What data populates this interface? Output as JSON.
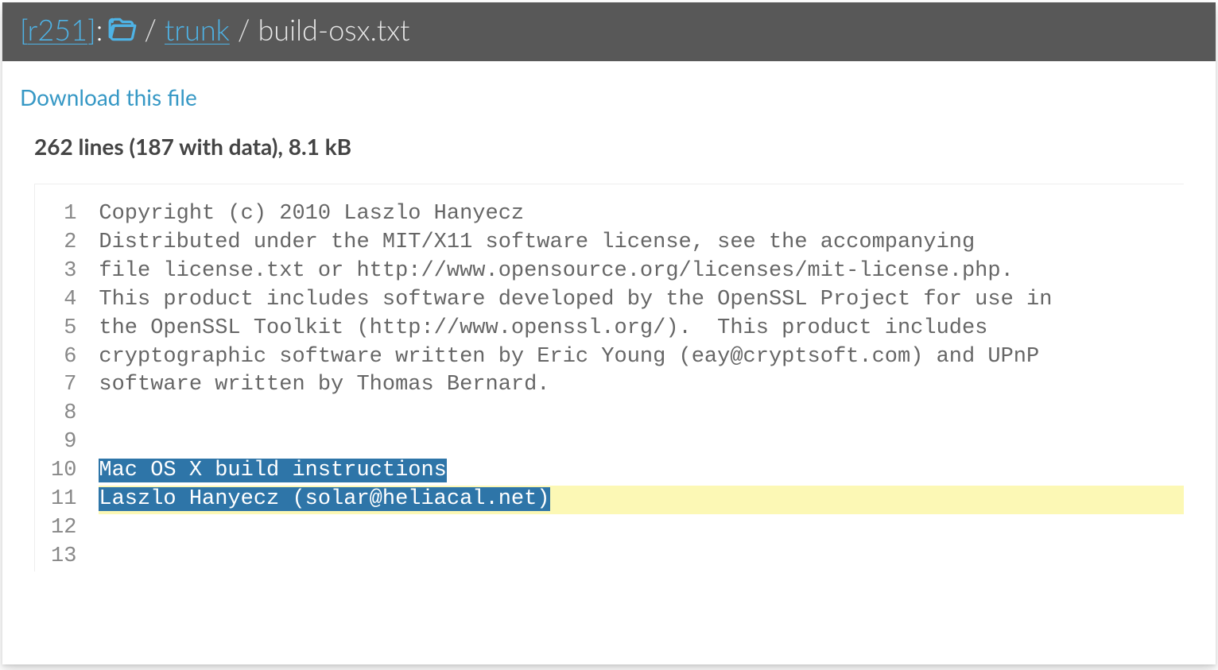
{
  "breadcrumb": {
    "revision_label": "r251",
    "trunk_label": "trunk",
    "filename": "build-osx.txt"
  },
  "download": {
    "label": "Download this file"
  },
  "stats": {
    "text": "262 lines (187 with data), 8.1 kB"
  },
  "code": {
    "lines": [
      {
        "n": 1,
        "text": "Copyright (c) 2010 Laszlo Hanyecz",
        "highlighted": false,
        "selected": false
      },
      {
        "n": 2,
        "text": "Distributed under the MIT/X11 software license, see the accompanying",
        "highlighted": false,
        "selected": false
      },
      {
        "n": 3,
        "text": "file license.txt or http://www.opensource.org/licenses/mit-license.php.",
        "highlighted": false,
        "selected": false
      },
      {
        "n": 4,
        "text": "This product includes software developed by the OpenSSL Project for use in",
        "highlighted": false,
        "selected": false
      },
      {
        "n": 5,
        "text": "the OpenSSL Toolkit (http://www.openssl.org/).  This product includes",
        "highlighted": false,
        "selected": false
      },
      {
        "n": 6,
        "text": "cryptographic software written by Eric Young (eay@cryptsoft.com) and UPnP ",
        "highlighted": false,
        "selected": false
      },
      {
        "n": 7,
        "text": "software written by Thomas Bernard.",
        "highlighted": false,
        "selected": false
      },
      {
        "n": 8,
        "text": "",
        "highlighted": false,
        "selected": false
      },
      {
        "n": 9,
        "text": "",
        "highlighted": false,
        "selected": false
      },
      {
        "n": 10,
        "text": "Mac OS X build instructions",
        "highlighted": false,
        "selected": true
      },
      {
        "n": 11,
        "text": "Laszlo Hanyecz (solar@heliacal.net)",
        "highlighted": true,
        "selected": true
      },
      {
        "n": 12,
        "text": "",
        "highlighted": false,
        "selected": false
      },
      {
        "n": 13,
        "text": "",
        "highlighted": false,
        "selected": false
      }
    ]
  }
}
